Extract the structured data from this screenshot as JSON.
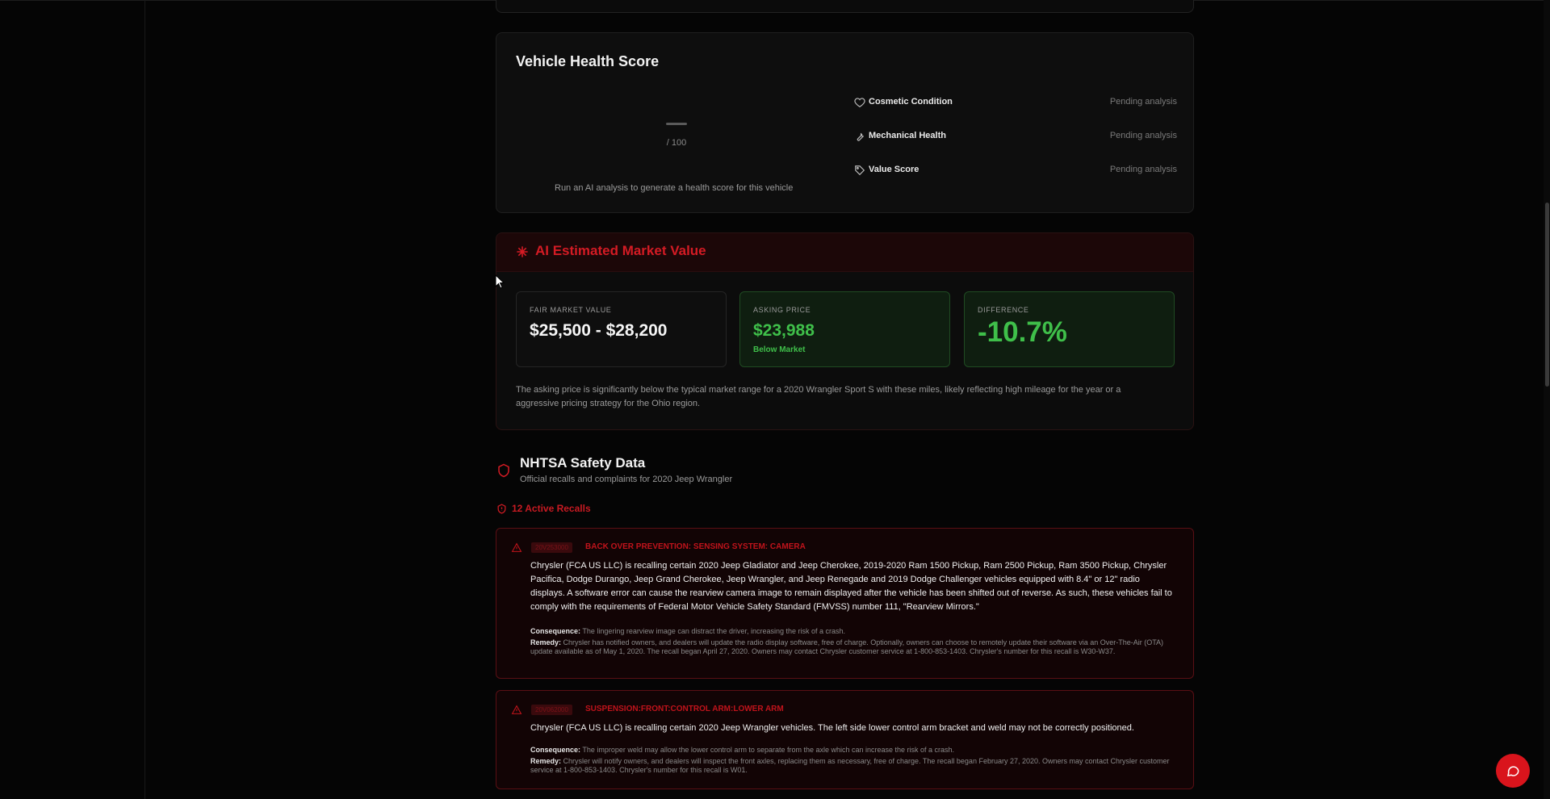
{
  "health": {
    "title": "Vehicle Health Score",
    "score_out_of": "/ 100",
    "hint": "Run an AI analysis to generate a health score for this vehicle",
    "metrics": [
      {
        "label": "Cosmetic Condition",
        "status": "Pending analysis",
        "icon": "heart-icon"
      },
      {
        "label": "Mechanical Health",
        "status": "Pending analysis",
        "icon": "wrench-icon"
      },
      {
        "label": "Value Score",
        "status": "Pending analysis",
        "icon": "tag-icon"
      }
    ]
  },
  "market": {
    "title": "AI Estimated Market Value",
    "icon": "sparkle-icon",
    "fair": {
      "label": "FAIR MARKET VALUE",
      "value": "$25,500 - $28,200"
    },
    "ask": {
      "label": "ASKING PRICE",
      "value": "$23,988",
      "sub": "Below Market"
    },
    "diff": {
      "label": "DIFFERENCE",
      "value": "-10.7%"
    },
    "description": "The asking price is significantly below the typical market range for a 2020 Wrangler Sport S with these miles, likely reflecting high mileage for the year or a aggressive pricing strategy for the Ohio region."
  },
  "nhtsa": {
    "title": "NHTSA Safety Data",
    "subtitle": "Official recalls and complaints for 2020 Jeep Wrangler",
    "recalls_count": "12 Active Recalls",
    "recalls": [
      {
        "id": "20V253000",
        "component": "BACK OVER PREVENTION: SENSING SYSTEM: CAMERA",
        "summary": "Chrysler (FCA US LLC) is recalling certain 2020 Jeep Gladiator and Jeep Cherokee, 2019-2020 Ram 1500 Pickup, Ram 2500 Pickup, Ram 3500 Pickup, Chrysler Pacifica, Dodge Durango, Jeep Grand Cherokee, Jeep Wrangler, and Jeep Renegade and 2019 Dodge Challenger vehicles equipped with 8.4\" or 12\" radio displays. A software error can cause the rearview camera image to remain displayed after the vehicle has been shifted out of reverse. As such, these vehicles fail to comply with the requirements of Federal Motor Vehicle Safety Standard (FMVSS) number 111, \"Rearview Mirrors.\"",
        "consequence_label": "Consequence:",
        "consequence": "The lingering rearview image can distract the driver, increasing the risk of a crash.",
        "remedy_label": "Remedy:",
        "remedy": "Chrysler has notified owners, and dealers will update the radio display software, free of charge. Optionally, owners can choose to remotely update their software via an Over-The-Air (OTA) update available as of May 1, 2020. The recall began April 27, 2020. Owners may contact Chrysler customer service at 1-800-853-1403. Chrysler's number for this recall is W30-W37."
      },
      {
        "id": "20V062000",
        "component": "SUSPENSION:FRONT:CONTROL ARM:LOWER ARM",
        "summary": "Chrysler (FCA US LLC) is recalling certain 2020 Jeep Wrangler vehicles. The left side lower control arm bracket and weld may not be correctly positioned.",
        "consequence_label": "Consequence:",
        "consequence": "The improper weld may allow the lower control arm to separate from the axle which can increase the risk of a crash.",
        "remedy_label": "Remedy:",
        "remedy": "Chrysler will notify owners, and dealers will inspect the front axles, replacing them as necessary, free of charge. The recall began February 27, 2020. Owners may contact Chrysler customer service at 1-800-853-1403. Chrysler's number for this recall is W01."
      }
    ]
  },
  "colors": {
    "accent_red": "#d41b24",
    "success_green": "#3fbf4a",
    "background": "#050505"
  },
  "chat": {
    "icon": "chat-bubble-icon"
  }
}
